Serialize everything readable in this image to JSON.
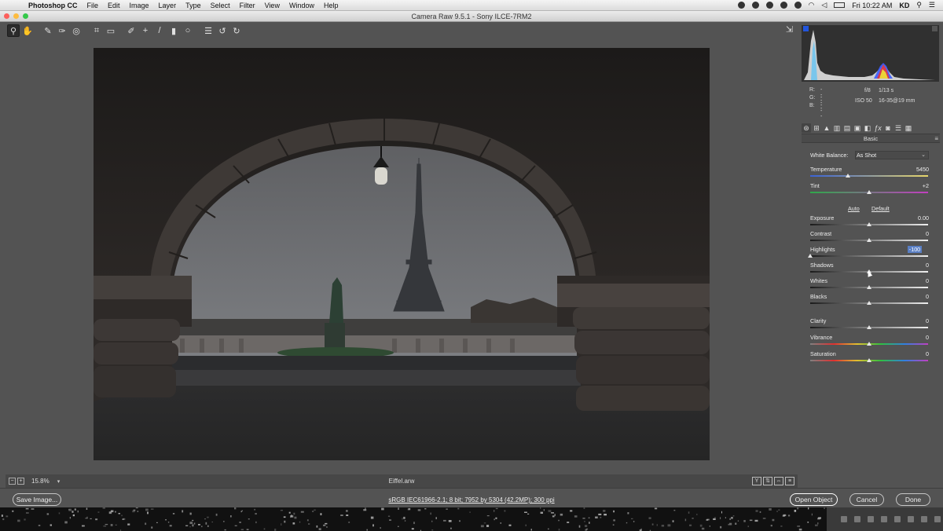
{
  "menubar": {
    "app_name": "Photoshop CC",
    "menus": [
      "File",
      "Edit",
      "Image",
      "Layer",
      "Type",
      "Select",
      "Filter",
      "View",
      "Window",
      "Help"
    ],
    "clock": "Fri 10:22 AM",
    "user": "KD"
  },
  "window": {
    "title": "Camera Raw 9.5.1  -  Sony ILCE-7RM2"
  },
  "toolbar": {
    "tools": [
      "zoom-icon",
      "hand-icon",
      "white-balance-icon",
      "color-sampler-icon",
      "target-adjust-icon",
      "crop-icon",
      "straighten-icon",
      "spot-removal-icon",
      "red-eye-icon",
      "adjustment-brush-icon",
      "graduated-filter-icon",
      "radial-filter-icon",
      "preferences-icon",
      "rotate-ccw-icon",
      "rotate-cw-icon"
    ]
  },
  "preview": {
    "zoom": "15.8%",
    "filename": "Eiffel.arw"
  },
  "bottom_bar": {
    "save_label": "Save Image...",
    "workflow": "sRGB IEC61966-2.1; 8 bit; 7952 by 5304 (42.2MP); 300 ppi",
    "open_label": "Open Object",
    "cancel_label": "Cancel",
    "done_label": "Done"
  },
  "camera_info": {
    "r_label": "R:",
    "r": "---",
    "g_label": "G:",
    "g": "---",
    "b_label": "B:",
    "b": "---",
    "aperture": "f/8",
    "shutter": "1/13 s",
    "iso": "ISO 50",
    "lens": "16-35@19 mm"
  },
  "panel": {
    "title": "Basic",
    "white_balance_label": "White Balance:",
    "white_balance_value": "As Shot",
    "auto_label": "Auto",
    "default_label": "Default"
  },
  "sliders": {
    "temperature": {
      "label": "Temperature",
      "value": "5450",
      "position": 0.32
    },
    "tint": {
      "label": "Tint",
      "value": "+2",
      "position": 0.5
    },
    "exposure": {
      "label": "Exposure",
      "value": "0.00",
      "position": 0.5
    },
    "contrast": {
      "label": "Contrast",
      "value": "0",
      "position": 0.5
    },
    "highlights": {
      "label": "Highlights",
      "value": "-100",
      "position": 0.0
    },
    "shadows": {
      "label": "Shadows",
      "value": "0",
      "position": 0.5
    },
    "whites": {
      "label": "Whites",
      "value": "0",
      "position": 0.5
    },
    "blacks": {
      "label": "Blacks",
      "value": "0",
      "position": 0.5
    },
    "clarity": {
      "label": "Clarity",
      "value": "0",
      "position": 0.5
    },
    "vibrance": {
      "label": "Vibrance",
      "value": "0",
      "position": 0.5
    },
    "saturation": {
      "label": "Saturation",
      "value": "0",
      "position": 0.5
    }
  }
}
